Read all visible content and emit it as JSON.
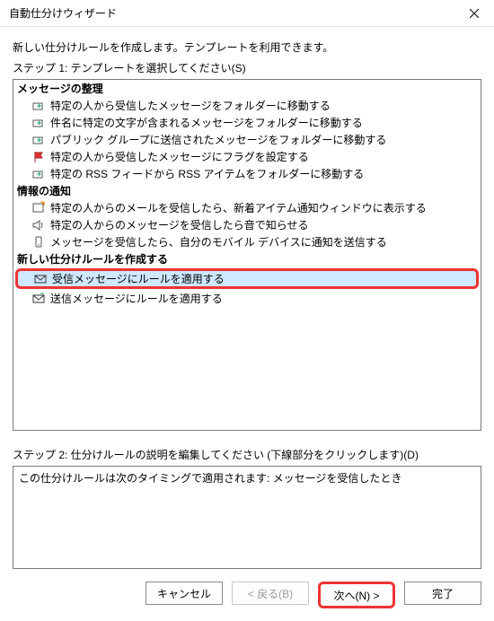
{
  "titlebar": {
    "title": "自動仕分けウィザード"
  },
  "intro": "新しい仕分けルールを作成します。テンプレートを利用できます。",
  "step1_label": "ステップ 1: テンプレートを選択してください(S)",
  "groups": {
    "g1_header": "メッセージの整理",
    "g1_items": [
      "特定の人から受信したメッセージをフォルダーに移動する",
      "件名に特定の文字が含まれるメッセージをフォルダーに移動する",
      "パブリック グループに送信されたメッセージをフォルダーに移動する",
      "特定の人から受信したメッセージにフラグを設定する",
      "特定の RSS フィードから RSS アイテムをフォルダーに移動する"
    ],
    "g2_header": "情報の通知",
    "g2_items": [
      "特定の人からのメールを受信したら、新着アイテム通知ウィンドウに表示する",
      "特定の人からのメッセージを受信したら音で知らせる",
      "メッセージを受信したら、自分のモバイル デバイスに通知を送信する"
    ],
    "g3_header": "新しい仕分けルールを作成する",
    "g3_items": [
      "受信メッセージにルールを適用する",
      "送信メッセージにルールを適用する"
    ]
  },
  "step2_label": "ステップ 2: 仕分けルールの説明を編集してください (下線部分をクリックします)(D)",
  "description": "この仕分けルールは次のタイミングで適用されます: メッセージを受信したとき",
  "buttons": {
    "cancel": "キャンセル",
    "back": "< 戻る(B)",
    "next": "次へ(N) >",
    "finish": "完了"
  }
}
